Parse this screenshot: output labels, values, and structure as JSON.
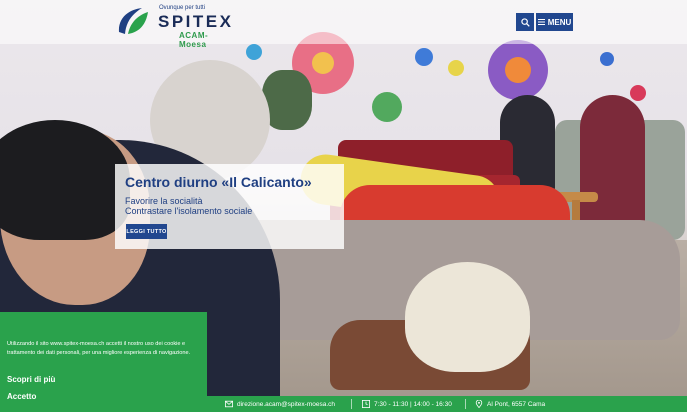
{
  "header": {
    "logo_tagline": "Ovunque per tutti",
    "logo_name": "SPITEX",
    "logo_subname": "ACAM-Moesa",
    "menu_label": "MENU",
    "search_icon": "search-icon",
    "menu_icon": "hamburger-icon"
  },
  "hero": {
    "title": "Centro diurno «Il Calicanto»",
    "line1": "Favorire la socialità",
    "line2": "Contrastare l'isolamento sociale",
    "button_label": "LEGGI TUTTO"
  },
  "cookie": {
    "text": "Utilizzando il sito www.spitex-moesa.ch accetti il nostro uso dei cookie e trattamento dei dati personali, per una migliore esperienza di navigazione.",
    "more_label": "Scopri di più",
    "accept_label": "Accetto"
  },
  "contact": {
    "email": "direzione.acam@spitex-moesa.ch",
    "hours": "7:30 - 11:30 | 14:00 - 16:30",
    "address": "Al Pont, 6557 Cama",
    "email_icon": "mail-icon",
    "hours_icon": "clock-icon",
    "address_icon": "location-pin-icon"
  },
  "colors": {
    "brand_blue": "#21478f",
    "brand_green": "#2aa24c",
    "logo_navy": "#1a2b57"
  }
}
